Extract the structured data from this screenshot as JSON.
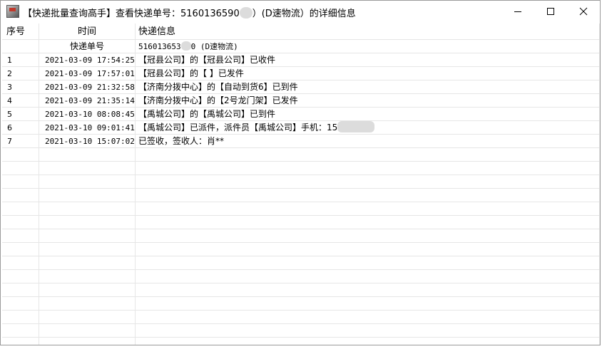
{
  "window": {
    "title_prefix": "【快递批量查询高手】查看快递单号：5160136590",
    "title_suffix": "）(D速物流）的详细信息",
    "controls": [
      "minimize",
      "maximize",
      "close"
    ]
  },
  "table": {
    "headers": {
      "index": "序号",
      "time": "时间",
      "info": "快递信息"
    },
    "subheader": {
      "time_label": "快递单号",
      "tracking_visible": "516013653",
      "tracking_suffix": "0 (D速物流)"
    },
    "rows": [
      {
        "index": "1",
        "time": "2021-03-09 17:54:25",
        "info": "【冠县公司】的【冠县公司】已收件"
      },
      {
        "index": "2",
        "time": "2021-03-09 17:57:01",
        "info": "【冠县公司】的【 】已发件"
      },
      {
        "index": "3",
        "time": "2021-03-09 21:32:58",
        "info": "【济南分拨中心】的【自动到货6】已到件"
      },
      {
        "index": "4",
        "time": "2021-03-09 21:35:14",
        "info": "【济南分拨中心】的【2号龙门架】已发件"
      },
      {
        "index": "5",
        "time": "2021-03-10 08:08:45",
        "info": "【禹城公司】的【禹城公司】已到件"
      },
      {
        "index": "6",
        "time": "2021-03-10 09:01:41",
        "info": "【禹城公司】已派件，派件员【禹城公司】手机：15"
      },
      {
        "index": "7",
        "time": "2021-03-10 15:07:02",
        "info": "已签收，签收人：肖**"
      }
    ]
  }
}
